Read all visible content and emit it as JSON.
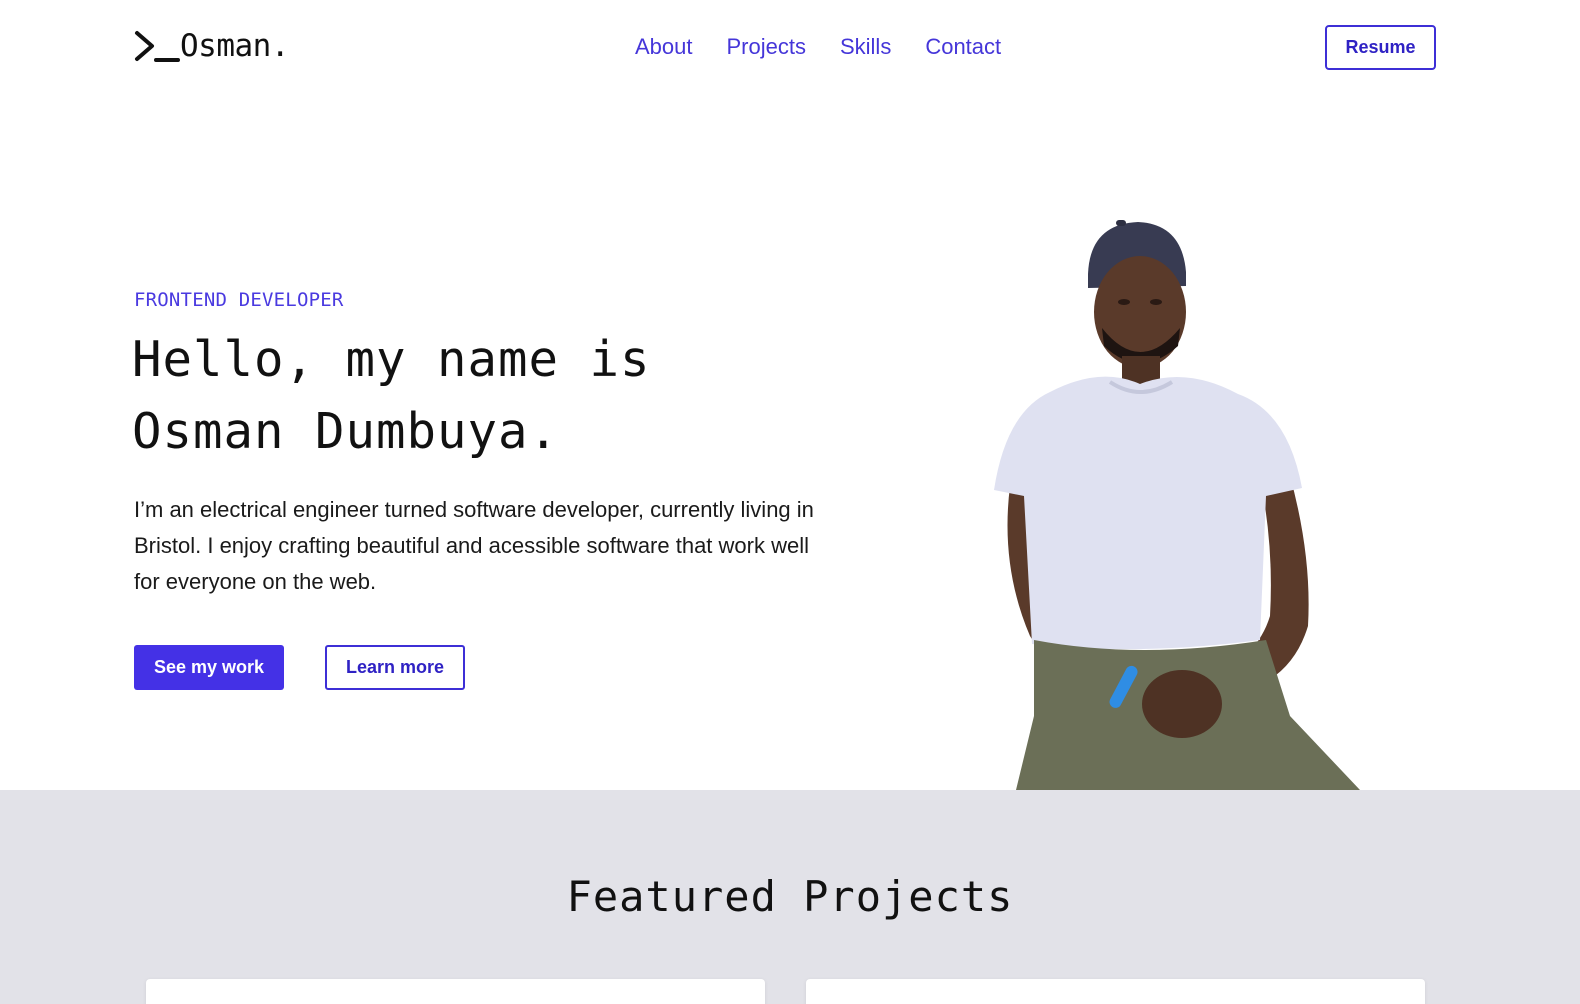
{
  "header": {
    "logo_text": "Osman.",
    "logo_icon": "terminal-prompt-icon",
    "nav": [
      "About",
      "Projects",
      "Skills",
      "Contact"
    ],
    "resume_label": "Resume"
  },
  "hero": {
    "eyebrow": "FRONTEND DEVELOPER",
    "headline": "Hello, my name is Osman Dumbuya.",
    "bio": "I’m an electrical engineer turned software developer, currently living in Bristol. I enjoy crafting beautiful and acessible software that work well for everyone on the web.",
    "primary_cta": "See my work",
    "secondary_cta": "Learn more"
  },
  "featured": {
    "title": "Featured Projects"
  },
  "colors": {
    "accent": "#4431e6",
    "nav_link": "#4536d9",
    "section_bg": "#e2e2e8"
  }
}
